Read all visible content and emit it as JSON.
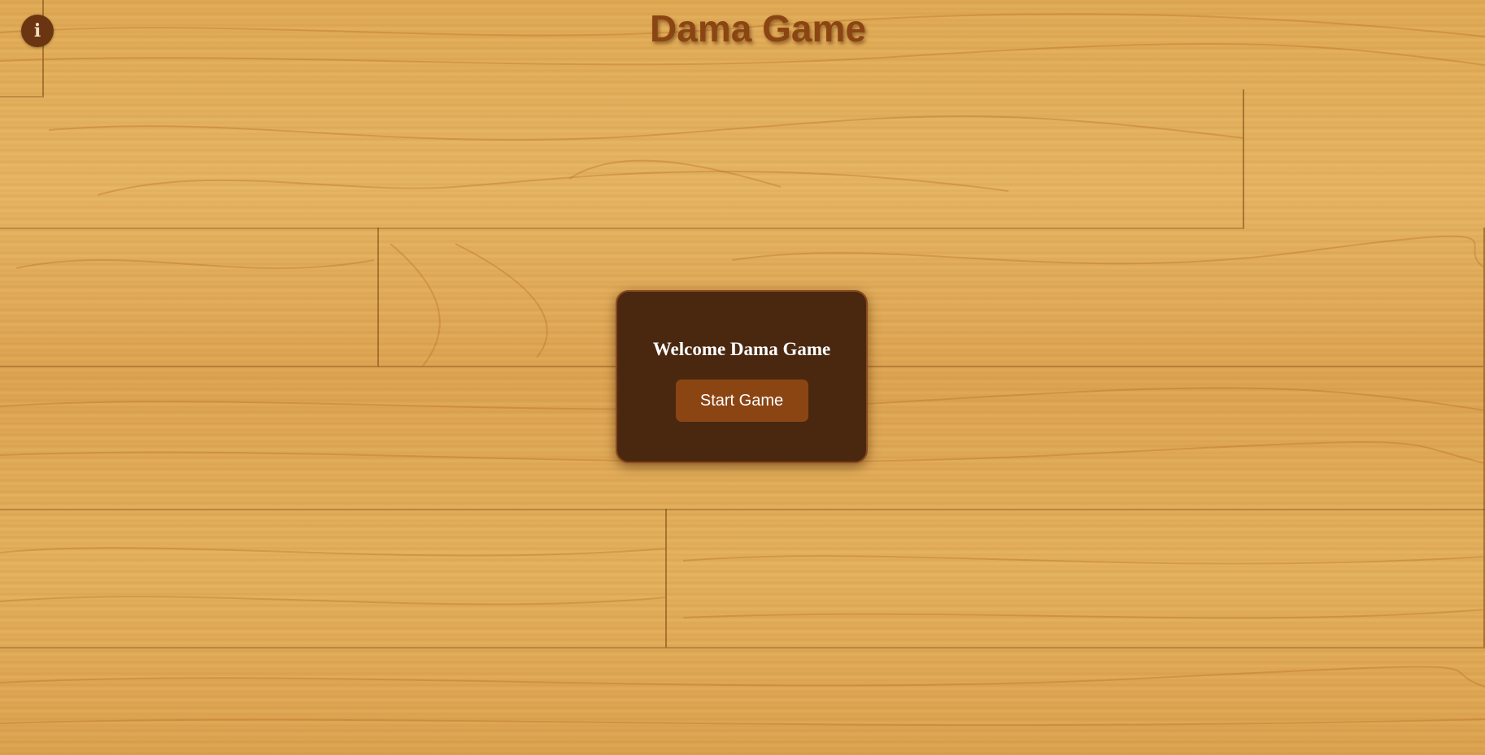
{
  "header": {
    "title": "Dama Game",
    "info_icon": "info-icon",
    "info_glyph": "i"
  },
  "welcome": {
    "title": "Welcome Dama Game",
    "start_label": "Start Game"
  },
  "colors": {
    "brand_brown": "#8b4513",
    "card_background": "#4a2810",
    "info_button": "#6b3512",
    "wood": "#e0aa55"
  }
}
